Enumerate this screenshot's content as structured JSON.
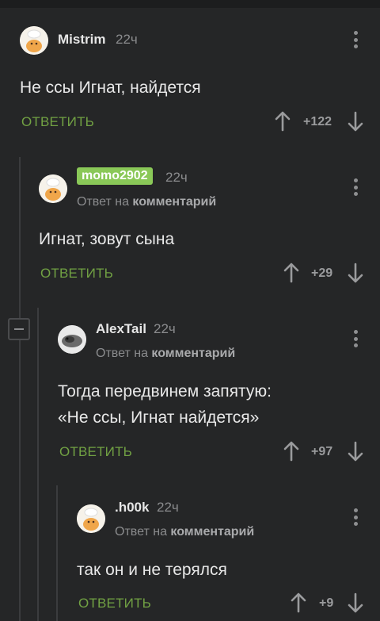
{
  "comments": [
    {
      "user": "Mistrim",
      "time": "22ч",
      "text": "Не ссы Игнат, найдется",
      "reply_label": "ОТВЕТИТЬ",
      "score": "+122"
    },
    {
      "user": "momo2902",
      "time": "22ч",
      "reply_prefix": "Ответ на",
      "reply_target": "комментарий",
      "text": "Игнат, зовут сына",
      "reply_label": "ОТВЕТИТЬ",
      "score": "+29"
    },
    {
      "user": "AlexTail",
      "time": "22ч",
      "reply_prefix": "Ответ на",
      "reply_target": "комментарий",
      "text_line1": "Тогда передвинем запятую:",
      "text_line2": "«Не ссы, Игнат найдется»",
      "reply_label": "ОТВЕТИТЬ",
      "score": "+97"
    },
    {
      "user": ".h00k",
      "time": "22ч",
      "reply_prefix": "Ответ на",
      "reply_target": "комментарий",
      "text": "так он и не терялся",
      "reply_label": "ОТВЕТИТЬ",
      "score": "+9"
    }
  ],
  "colors": {
    "background": "#252627",
    "accent_green": "#71a143",
    "badge_green": "#8ac858",
    "muted": "#8b8c8e"
  },
  "icons": [
    "avatar-chef",
    "kebab-menu-icon",
    "arrow-up-icon",
    "arrow-down-icon",
    "collapse-icon"
  ]
}
